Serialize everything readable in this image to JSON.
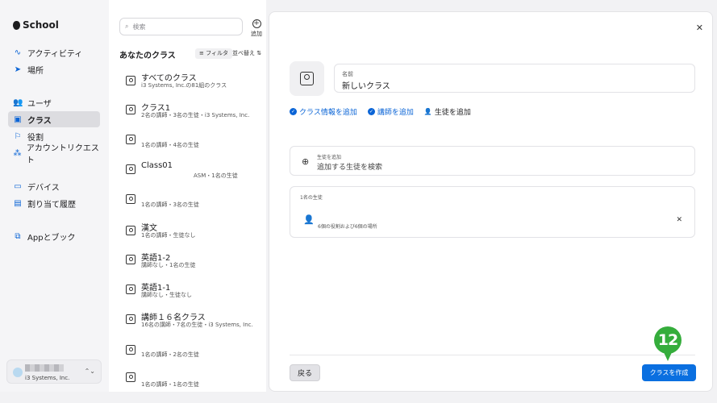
{
  "brand": "School",
  "sidebar": {
    "items": [
      {
        "label": "アクティビティ",
        "icon": "activity-icon"
      },
      {
        "label": "場所",
        "icon": "location-icon"
      },
      {
        "label": "ユーザ",
        "icon": "users-icon"
      },
      {
        "label": "クラス",
        "icon": "class-icon",
        "active": true
      },
      {
        "label": "役割",
        "icon": "flag-icon"
      },
      {
        "label": "アカウントリクエスト",
        "icon": "account-request-icon"
      },
      {
        "label": "デバイス",
        "icon": "device-icon"
      },
      {
        "label": "割り当て履歴",
        "icon": "history-icon"
      },
      {
        "label": "Appとブック",
        "icon": "apps-books-icon"
      }
    ],
    "account": {
      "org": "i3 Systems, Inc."
    }
  },
  "list": {
    "search_placeholder": "検索",
    "add_label": "追加",
    "title": "あなたのクラス",
    "filter_label": "フィルタ",
    "sort_label": "並べ替え",
    "rows": [
      {
        "title": "すべてのクラス",
        "sub": "i3 Systems, Inc.の81組のクラス"
      },
      {
        "title": "クラス1",
        "sub": "2名の講師・3名の生徒・i3 Systems, Inc."
      },
      {
        "title": "",
        "sub": "1名の講師・4名の生徒"
      },
      {
        "title": "Class01",
        "sub": "ASM・1名の生徒"
      },
      {
        "title": "",
        "sub": "1名の講師・3名の生徒"
      },
      {
        "title": "漢文",
        "sub": "1名の講師・生徒なし"
      },
      {
        "title": "英語1-2",
        "sub": "講師なし・1名の生徒"
      },
      {
        "title": "英語1-1",
        "sub": "講師なし・生徒なし"
      },
      {
        "title": "講師１６名クラス",
        "sub": "16名の講師・7名の生徒・i3 Systems, Inc."
      },
      {
        "title": "",
        "sub": "1名の講師・2名の生徒"
      },
      {
        "title": "",
        "sub": "1名の講師・1名の生徒"
      }
    ]
  },
  "sheet": {
    "name_label": "名前",
    "name_value": "新しいクラス",
    "steps": [
      {
        "label": "クラス情報を追加",
        "done": true
      },
      {
        "label": "講師を追加",
        "done": true
      },
      {
        "label": "生徒を追加",
        "done": false
      }
    ],
    "add_student_label": "生徒を追加",
    "add_student_placeholder": "追加する生徒を検索",
    "students_header": "1名の生徒",
    "student_desc": "6個の役割および6個の場所",
    "back_label": "戻る",
    "create_label": "クラスを作成"
  },
  "marker": "12",
  "colors": {
    "accent": "#0a6fe0",
    "marker": "#35ad3c"
  }
}
